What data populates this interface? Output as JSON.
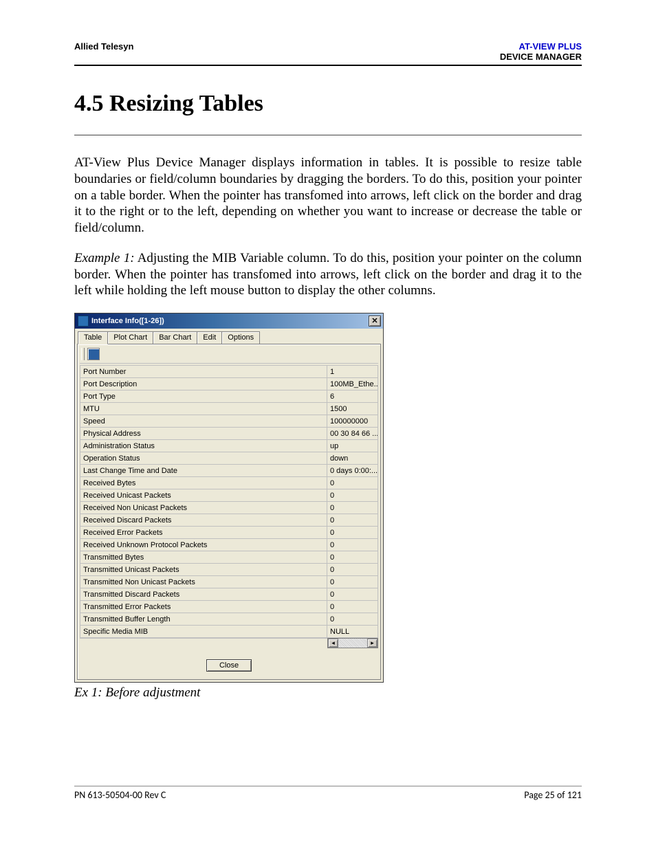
{
  "header": {
    "left": "Allied Telesyn",
    "right_product": "AT-VIEW PLUS",
    "right_sub": "DEVICE MANAGER"
  },
  "section": {
    "title": "4.5 Resizing Tables",
    "para1": "AT-View Plus Device Manager displays information in tables. It is possible to resize table boundaries or field/column boundaries by dragging the borders. To do this, position your pointer on a table border. When the pointer has transfomed into arrows, left click on the border and drag it to the right or to the left, depending on whether you want to increase or decrease the table or field/column.",
    "example_label": "Example 1:",
    "example_text": " Adjusting the MIB Variable column. To do this, position your pointer on the column border. When the pointer has transfomed into arrows, left click on the border and drag it to the left while holding the left mouse button to display the other columns.",
    "caption": "Ex 1: Before adjustment"
  },
  "window": {
    "title": "Interface Info([1-26])",
    "tabs": [
      "Table",
      "Plot Chart",
      "Bar Chart",
      "Edit",
      "Options"
    ],
    "active_tab": 0,
    "toolbar_icon": "table-icon",
    "close_button": "close",
    "rows": [
      {
        "label": "Port Number",
        "value": "1"
      },
      {
        "label": "Port Description",
        "value": "100MB_Ethe..."
      },
      {
        "label": "Port Type",
        "value": "6"
      },
      {
        "label": "MTU",
        "value": "1500"
      },
      {
        "label": "Speed",
        "value": "100000000"
      },
      {
        "label": "Physical Address",
        "value": "00 30 84 66 ..."
      },
      {
        "label": "Administration Status",
        "value": "up"
      },
      {
        "label": "Operation Status",
        "value": "down"
      },
      {
        "label": "Last Change Time and Date",
        "value": "0 days 0:00:..."
      },
      {
        "label": "Received Bytes",
        "value": "0"
      },
      {
        "label": "Received Unicast Packets",
        "value": "0"
      },
      {
        "label": "Received Non Unicast Packets",
        "value": "0"
      },
      {
        "label": "Received Discard Packets",
        "value": "0"
      },
      {
        "label": "Received Error Packets",
        "value": "0"
      },
      {
        "label": "Received Unknown Protocol Packets",
        "value": "0"
      },
      {
        "label": "Transmitted Bytes",
        "value": "0"
      },
      {
        "label": "Transmitted Unicast Packets",
        "value": "0"
      },
      {
        "label": "Transmitted Non Unicast Packets",
        "value": "0"
      },
      {
        "label": "Transmitted Discard Packets",
        "value": "0"
      },
      {
        "label": "Transmitted Error Packets",
        "value": "0"
      },
      {
        "label": "Transmitted Buffer Length",
        "value": "0"
      },
      {
        "label": "Specific Media MIB",
        "value": "NULL"
      }
    ],
    "close_label": "Close"
  },
  "footer": {
    "left": "PN 613-50504-00 Rev C",
    "right": "Page 25 of 121"
  }
}
